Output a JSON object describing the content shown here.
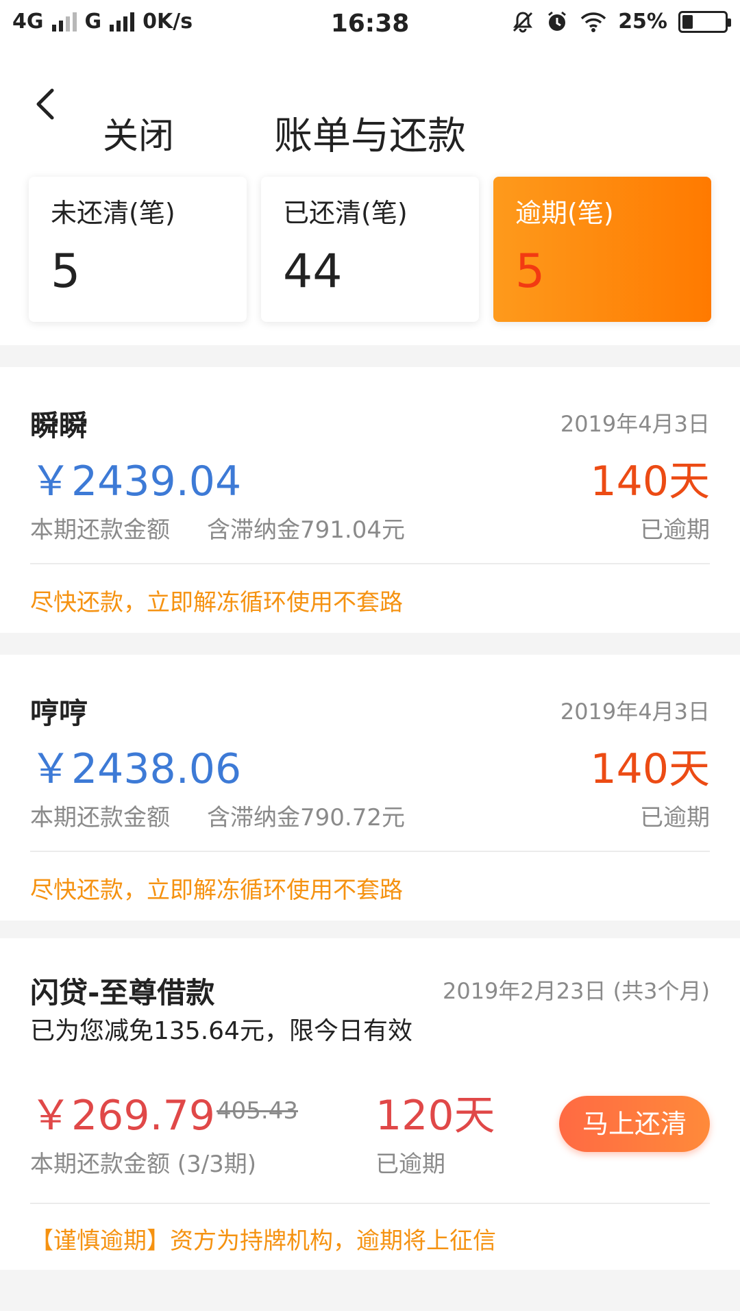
{
  "status_bar": {
    "net1": "4G",
    "net2": "G",
    "speed": "0K/s",
    "time": "16:38",
    "battery_text": "25%",
    "battery_level": 0.25
  },
  "nav": {
    "close": "关闭",
    "title": "账单与还款"
  },
  "summary": [
    {
      "label": "未还清(笔)",
      "value": "5"
    },
    {
      "label": "已还清(笔)",
      "value": "44"
    },
    {
      "label": "逾期(笔)",
      "value": "5"
    }
  ],
  "bills": [
    {
      "name": "瞬瞬",
      "date": "2019年4月3日",
      "amount": "￥2439.04",
      "amount_label": "本期还款金额",
      "late_fee": "含滞纳金791.04元",
      "days": "140天",
      "days_label": "已逾期",
      "tip": "尽快还款，立即解冻循环使用不套路"
    },
    {
      "name": "哼哼",
      "date": "2019年4月3日",
      "amount": "￥2438.06",
      "amount_label": "本期还款金额",
      "late_fee": "含滞纳金790.72元",
      "days": "140天",
      "days_label": "已逾期",
      "tip": "尽快还款，立即解冻循环使用不套路"
    },
    {
      "name": "闪贷-至尊借款",
      "date": "2019年2月23日 (共3个月)",
      "discount": "已为您减免135.64元，限今日有效",
      "amount": "￥269.79",
      "original": "405.43",
      "amount_label": "本期还款金额 (3/3期)",
      "days": "120天",
      "days_label": "已逾期",
      "button": "马上还清",
      "tip": "【谨慎逾期】资方为持牌机构，逾期将上征信"
    }
  ],
  "colors": {
    "accent_orange": "#ff7a00",
    "amount_blue": "#3d7ad6",
    "overdue_red": "#ec4b14",
    "tip_orange": "#f59211"
  }
}
